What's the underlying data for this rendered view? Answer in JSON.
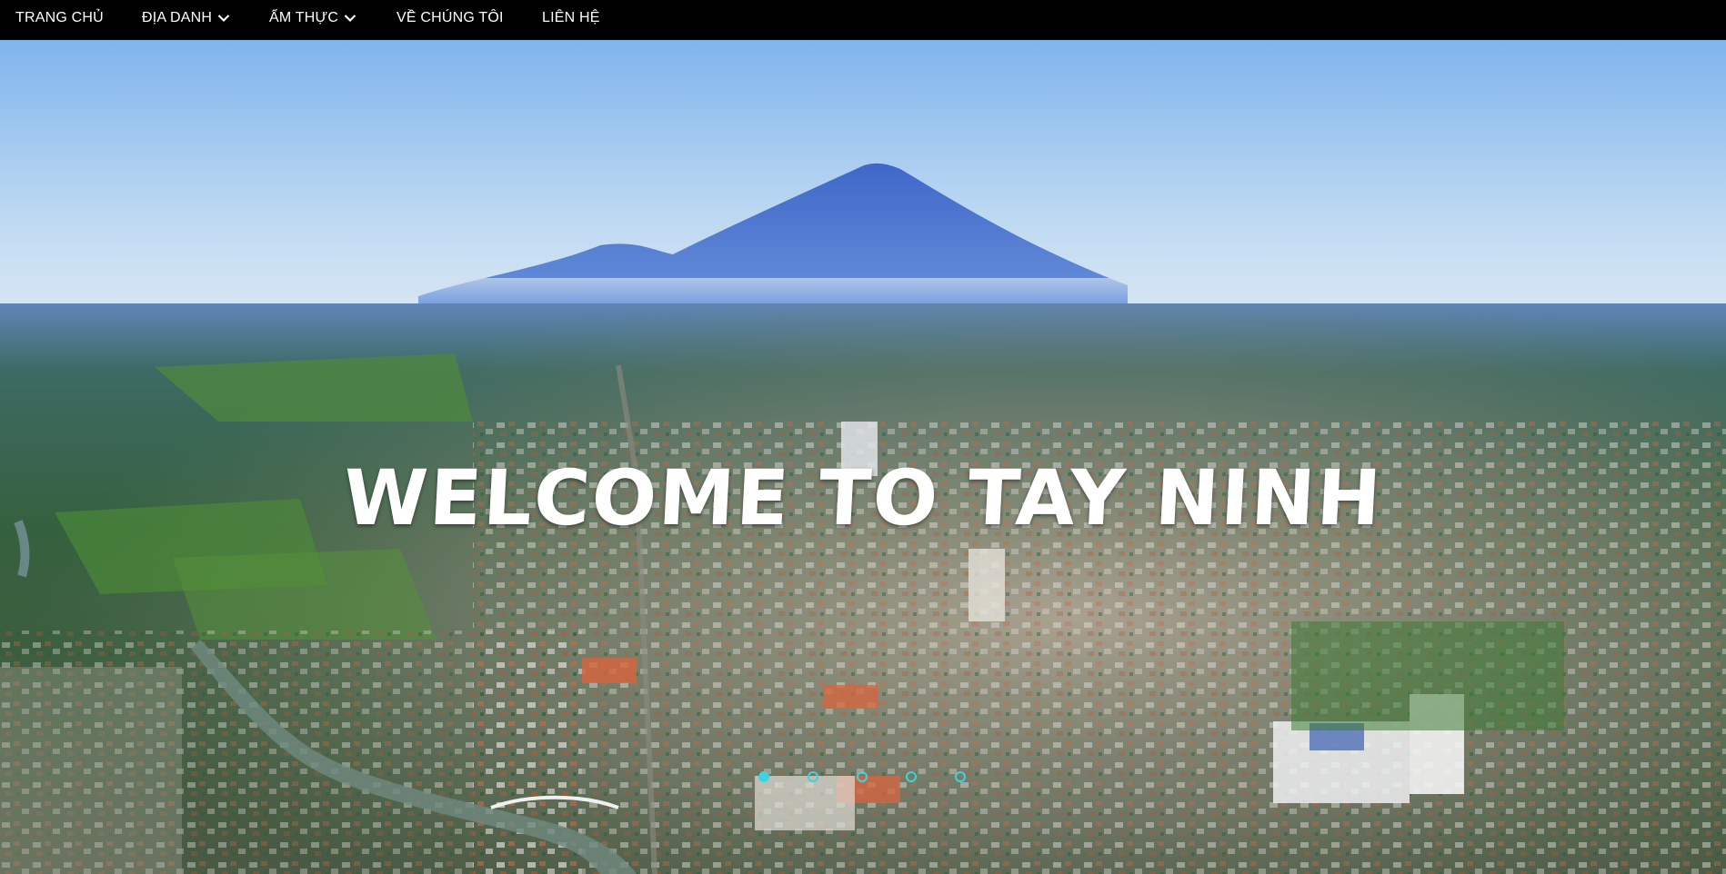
{
  "nav": {
    "items": [
      {
        "label": "TRANG CHỦ",
        "dropdown": false
      },
      {
        "label": "ĐỊA DANH",
        "dropdown": true
      },
      {
        "label": "ẨM THỰC",
        "dropdown": true
      },
      {
        "label": "VỀ CHÚNG TÔI",
        "dropdown": false
      },
      {
        "label": "LIÊN HỆ",
        "dropdown": false
      }
    ]
  },
  "hero": {
    "headline": "WELCOME TO TAY NINH",
    "slides_count": 5,
    "active_slide": 1
  },
  "colors": {
    "navbar_bg": "#000000",
    "nav_text": "#ffffff",
    "indicator": "#3fd3df"
  }
}
